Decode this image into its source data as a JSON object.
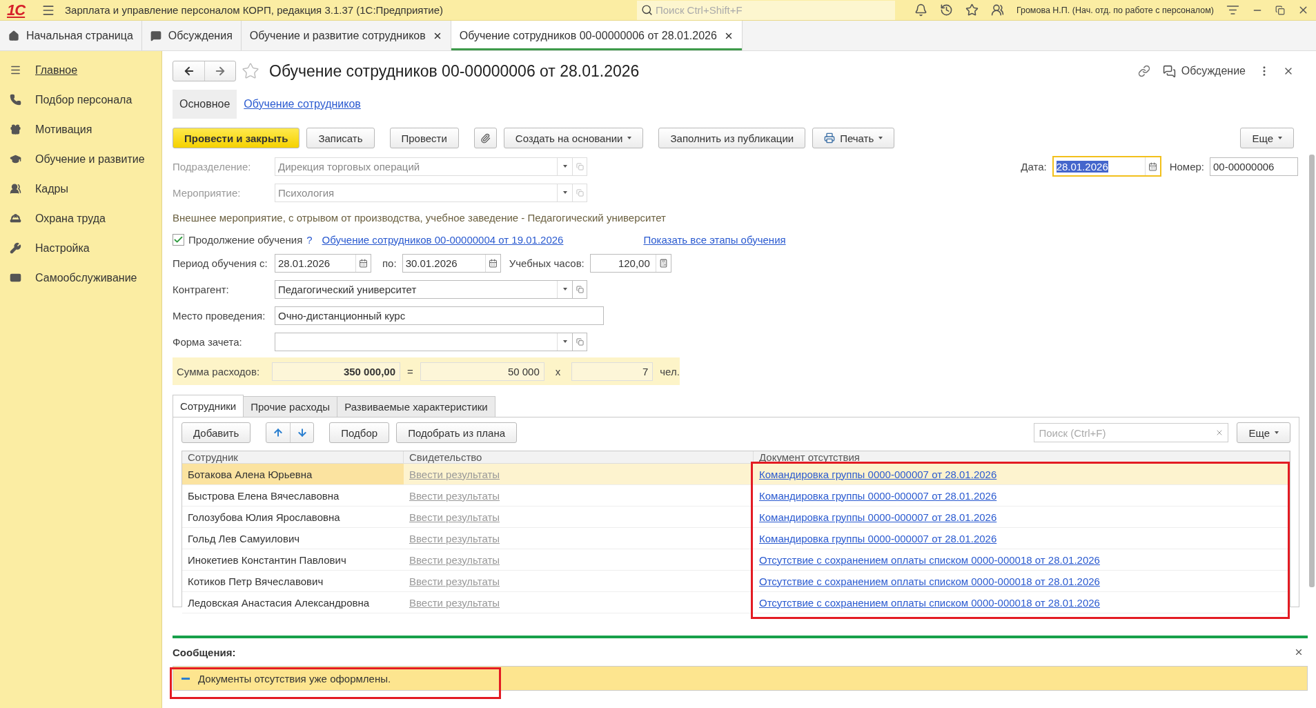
{
  "app_bar": {
    "logo": "1С",
    "title": "Зарплата и управление персоналом КОРП, редакция 3.1.37  (1С:Предприятие)",
    "search_placeholder": "Поиск Ctrl+Shift+F",
    "user": "Громова Н.П. (Нач. отд. по работе с персоналом)"
  },
  "open_tabs": [
    {
      "label": "Начальная страница",
      "kind": "home",
      "selected": false
    },
    {
      "label": "Обсуждения",
      "kind": "chat",
      "selected": false
    },
    {
      "label": "Обучение и развитие сотрудников",
      "kind": "closable",
      "selected": false
    },
    {
      "label": "Обучение сотрудников 00-00000006 от 28.01.2026",
      "kind": "closable",
      "selected": true
    }
  ],
  "sidebar": {
    "items": [
      {
        "label": "Главное",
        "kind": "menu",
        "selected": true
      },
      {
        "label": "Подбор персонала",
        "kind": "phone",
        "selected": false
      },
      {
        "label": "Мотивация",
        "kind": "gift",
        "selected": false
      },
      {
        "label": "Обучение и развитие",
        "kind": "graduation",
        "selected": false
      },
      {
        "label": "Кадры",
        "kind": "people",
        "selected": false
      },
      {
        "label": "Охрана труда",
        "kind": "helmet",
        "selected": false
      },
      {
        "label": "Настройка",
        "kind": "wrench",
        "selected": false
      },
      {
        "label": "Самообслуживание",
        "kind": "card",
        "selected": false
      }
    ]
  },
  "form": {
    "title": "Обучение сотрудников 00-00000006 от 28.01.2026",
    "discussion": "Обсуждение",
    "sections": [
      {
        "label": "Основное",
        "selected": true
      },
      {
        "label": "Обучение сотрудников",
        "selected": false
      }
    ],
    "toolbar": [
      {
        "label": "Провести и закрыть",
        "kind": "primary"
      },
      {
        "label": "Записать",
        "kind": "plain"
      },
      {
        "label": "Провести",
        "kind": "plain"
      },
      {
        "kind": "attach"
      },
      {
        "label": "Создать на основании",
        "kind": "dropdown"
      },
      {
        "label": "Заполнить из публикации",
        "kind": "plain"
      },
      {
        "label": "Печать",
        "kind": "print"
      }
    ],
    "more": "Еще",
    "date": {
      "label": "Дата:",
      "value": "28.01.2026"
    },
    "number": {
      "label": "Номер:",
      "value": "00-00000006"
    },
    "subdivision": {
      "label": "Подразделение:",
      "value": "Дирекция торговых операций",
      "disabled": true
    },
    "event": {
      "label": "Мероприятие:",
      "value": "Психология",
      "disabled": true
    },
    "event_info": "Внешнее мероприятие, с отрывом от производства, учебное заведение - Педагогический университет",
    "continuation": {
      "label": "Продолжение обучения",
      "checked": true,
      "help": "?",
      "link": "Обучение сотрудников 00-00000004 от 19.01.2026",
      "show_all": "Показать все этапы обучения"
    },
    "period": {
      "label": "Период обучения с:",
      "from": "28.01.2026",
      "to_label": "по:",
      "to": "30.01.2026",
      "hours_label": "Учебных часов:",
      "hours": "120,00"
    },
    "counterparty": {
      "label": "Контрагент:",
      "value": "Педагогический университет",
      "disabled": false
    },
    "venue": {
      "label": "Место проведения:",
      "value": "Очно-дистанционный курс"
    },
    "assessment": {
      "label": "Форма зачета:",
      "disabled": false
    },
    "expenses": {
      "label": "Сумма расходов:",
      "total": "350 000,00",
      "eq": "=",
      "per_person": "50 000",
      "times": "x",
      "count": "7",
      "unit": "чел."
    },
    "table_tabs": [
      {
        "label": "Сотрудники",
        "selected": true
      },
      {
        "label": "Прочие расходы",
        "selected": false
      },
      {
        "label": "Развиваемые характеристики",
        "selected": false
      }
    ],
    "table_toolbar": {
      "add": "Добавить",
      "pick": "Подбор",
      "pick_plan": "Подобрать из плана",
      "search_placeholder": "Поиск (Ctrl+F)",
      "more": "Еще"
    },
    "table": {
      "columns": [
        "Сотрудник",
        "Свидетельство",
        "Документ отсутствия"
      ],
      "rows": [
        {
          "employee": "Ботакова Алена Юрьевна",
          "certificate": "Ввести результаты",
          "absence_doc": "Командировка группы 0000-000007 от 28.01.2026",
          "selected": true
        },
        {
          "employee": "Быстрова Елена Вячеславовна",
          "certificate": "Ввести результаты",
          "absence_doc": "Командировка группы 0000-000007 от 28.01.2026",
          "selected": false
        },
        {
          "employee": "Голозубова Юлия Ярославовна",
          "certificate": "Ввести результаты",
          "absence_doc": "Командировка группы 0000-000007 от 28.01.2026",
          "selected": false
        },
        {
          "employee": "Гольд Лев Самуилович",
          "certificate": "Ввести результаты",
          "absence_doc": "Командировка группы 0000-000007 от 28.01.2026",
          "selected": false
        },
        {
          "employee": "Инокетиев Константин Павлович",
          "certificate": "Ввести результаты",
          "absence_doc": "Отсутствие с сохранением оплаты списком 0000-000018 от 28.01.2026",
          "selected": false
        },
        {
          "employee": "Котиков Петр Вячеславович",
          "certificate": "Ввести результаты",
          "absence_doc": "Отсутствие с сохранением оплаты списком 0000-000018 от 28.01.2026",
          "selected": false
        },
        {
          "employee": "Ледовская Анастасия Александровна",
          "certificate": "Ввести результаты",
          "absence_doc": "Отсутствие с сохранением оплаты списком 0000-000018 от 28.01.2026",
          "selected": false
        }
      ]
    }
  },
  "messages": {
    "title": "Сообщения:",
    "items": [
      "Документы отсутствия уже оформлены."
    ]
  }
}
